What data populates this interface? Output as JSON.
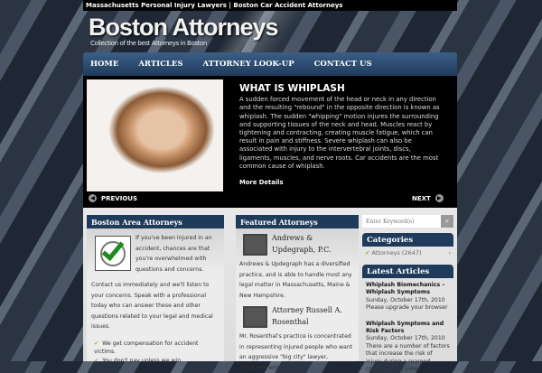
{
  "topbar": "Massachusetts Personal Injury Lawyers | Boston Car Accident Attorneys",
  "header": {
    "logo": "Boston Attorneys",
    "tagline": "Collection of the best Attorneys in Boston"
  },
  "nav": [
    "HOME",
    "ARTICLES",
    "ATTORNEY LOOK-UP",
    "CONTACT US"
  ],
  "slider": {
    "title": "WHAT IS WHIPLASH",
    "body": "A sudden forced movement of the head or neck in any direction and the resulting \"rebound\" in the opposite direction is known as whiplash. The sudden \"whipping\" motion injures the surrounding and supporting tissues of the neck and head. Muscles react by tightening and contracting, creating muscle fatigue, which can result in pain and stiffness. Severe whiplash can also be associated with injury to the intervertebral joints, discs, ligaments, muscles, and nerve roots. Car accidents are the most common cause of whiplash.",
    "more": "More Details",
    "prev": "PREVIOUS",
    "next": "NEXT"
  },
  "left": {
    "title": "Boston Area Attorneys",
    "intro": "If you've been injured in an accident, chances are that you're overwhelmed with questions and concerns.",
    "body": "Contact us immediately and we'll listen to your concerns. Speak with a professional today who can answer these and other questions related to your legal and medical issues.",
    "bullets": [
      "We get compensation for accident victims.",
      "You don't pay unless we win."
    ]
  },
  "mid": {
    "title": "Featured Attorneys",
    "items": [
      {
        "name": "Andrews & Updegraph, P.C.",
        "desc": "Andrews & Updegraph has a diversified practice, and is able to handle most any legal matter in Massachusetts, Maine & New Hampshire."
      },
      {
        "name": "Attorney Russell A. Rosenthal",
        "desc": "Mr. Rosenthal's practice is concentrated in representing injured people who want an aggressive \"big city\" lawyer, combined with a"
      }
    ]
  },
  "right": {
    "search_placeholder": "Enter Keyword(s)",
    "categories_title": "Categories",
    "category": "Attorneys (2647)",
    "latest_title": "Latest Articles",
    "articles": [
      {
        "title": "Whiplash Biomechanics – Whiplash Symptoms",
        "date": "Sunday, October 17th, 2010",
        "excerpt": "Please upgrade your browser"
      },
      {
        "title": "Whiplash Symptoms and Risk Factors",
        "date": "Sunday, October 17th, 2010",
        "excerpt": "There are a number of factors that increase the risk of injury during a rearend collision. This video"
      }
    ]
  }
}
